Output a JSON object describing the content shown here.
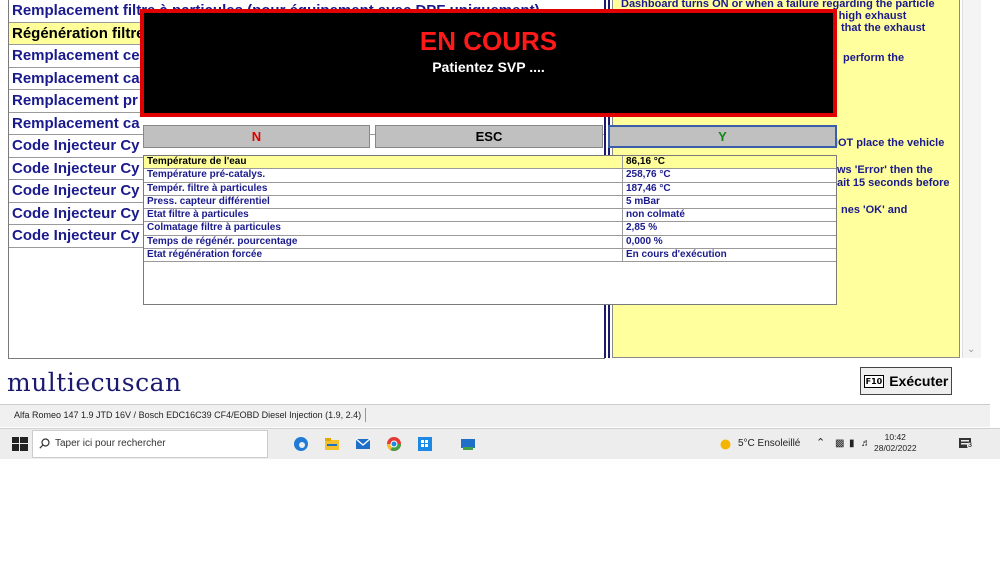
{
  "list": {
    "items": [
      "Remplacement filtre à particules (pour équipement avec DPF uniquement)",
      "Régénération filtre",
      "Remplacement ce",
      "Remplacement ca",
      "Remplacement pr",
      "Remplacement ca",
      "Code Injecteur Cy",
      "Code Injecteur Cy",
      "Code Injecteur Cy",
      "Code Injecteur Cy",
      "Code Injecteur Cy"
    ]
  },
  "info": {
    "lines": [
      "Dashboard turns ON or when a failure regarding the particle",
      "ery high exhaust",
      "that the exhaust",
      "perform the",
      "NOT place the vehicle",
      "ws 'Error' then the",
      "ait 15 seconds before",
      "nes 'OK' and"
    ]
  },
  "dialog": {
    "title": "EN COURS",
    "subtitle": "Patientez SVP ....",
    "btn_n": "N",
    "btn_esc": "ESC",
    "btn_y": "Y",
    "rows": [
      {
        "label": "Température de l'eau",
        "value": "86,16 °C"
      },
      {
        "label": "Température pré-catalys.",
        "value": "258,76 °C"
      },
      {
        "label": "Tempér. filtre à particules",
        "value": "187,46 °C"
      },
      {
        "label": "Press. capteur différentiel",
        "value": "5 mBar"
      },
      {
        "label": "Etat filtre à particules",
        "value": "non colmaté"
      },
      {
        "label": "Colmatage filtre  à particules",
        "value": "2,85 %"
      },
      {
        "label": "Temps de régénér. pourcentage",
        "value": "0,000 %"
      },
      {
        "label": "Etat régénération forcée",
        "value": "En cours d'exécution"
      }
    ]
  },
  "app": {
    "logo": "multiecuscan",
    "exec_key": "F10",
    "exec_label": "Exécuter",
    "status": "Alfa Romeo 147 1.9 JTD 16V / Bosch EDC16C39 CF4/EOBD Diesel Injection (1.9, 2.4)"
  },
  "taskbar": {
    "search_placeholder": "Taper ici pour rechercher",
    "weather": "5°C  Ensoleillé",
    "time": "10:42",
    "date": "28/02/2022",
    "notif_count": "3"
  },
  "colors": {
    "accent": "#1a1a8c",
    "highlight": "#ffff99",
    "alert": "#e00000"
  }
}
